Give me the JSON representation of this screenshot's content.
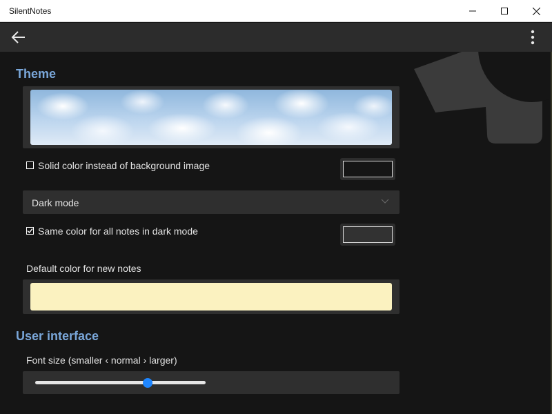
{
  "window": {
    "title": "SilentNotes"
  },
  "appbar": {
    "back_icon": "arrow-left-icon",
    "more_icon": "more-vertical-icon"
  },
  "theme": {
    "section_title": "Theme",
    "background_image": "clouds",
    "solid_color_label": "Solid color instead of background image",
    "solid_color_checked": false,
    "solid_color_value": "#151515",
    "dark_mode_selected": "Dark mode",
    "same_color_label": "Same color for all notes in dark mode",
    "same_color_checked": true,
    "same_color_value": "#323232",
    "default_color_label": "Default color for new notes",
    "default_color_value": "#fbf2c0"
  },
  "user_interface": {
    "section_title": "User interface",
    "font_size_label": "Font size (smaller ‹ normal › larger)",
    "font_size_level": 0.66
  },
  "colors": {
    "accent": "#1e86ff",
    "section_title": "#7aa7da",
    "appbar": "#2c2c2c",
    "background": "#151515"
  }
}
